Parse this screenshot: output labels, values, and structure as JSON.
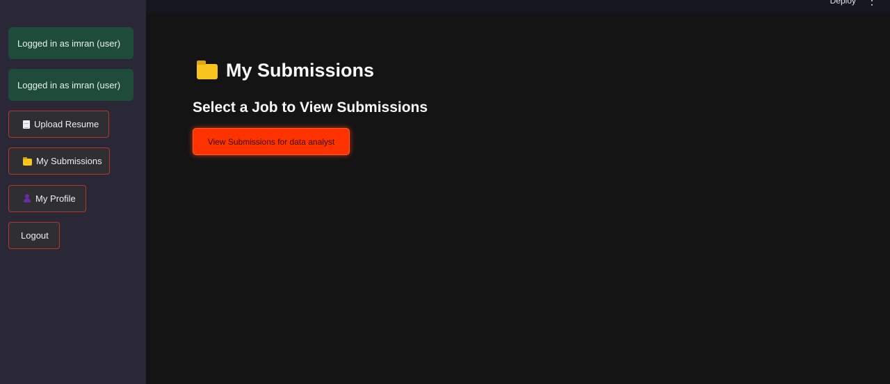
{
  "header": {
    "deploy_label": "Deploy",
    "menu_icon": "kebab-menu-icon"
  },
  "sidebar": {
    "alerts": [
      "Logged in as imran (user)",
      "Logged in as imran (user)"
    ],
    "nav": {
      "upload_resume": {
        "label": "Upload Resume",
        "icon": "document-icon"
      },
      "my_submissions": {
        "label": "My Submissions",
        "icon": "folder-icon"
      },
      "my_profile": {
        "label": "My Profile",
        "icon": "person-icon"
      },
      "logout": {
        "label": "Logout"
      }
    }
  },
  "main": {
    "title": "My Submissions",
    "title_icon": "folder-icon",
    "subheading": "Select a Job to View Submissions",
    "view_button_label": "View Submissions for data analyst"
  },
  "colors": {
    "sidebar_bg": "#2a2836",
    "main_bg": "#141414",
    "success_alert_bg": "#1f4c3a",
    "button_border": "#b8372a",
    "primary_button": "#ff3300"
  }
}
